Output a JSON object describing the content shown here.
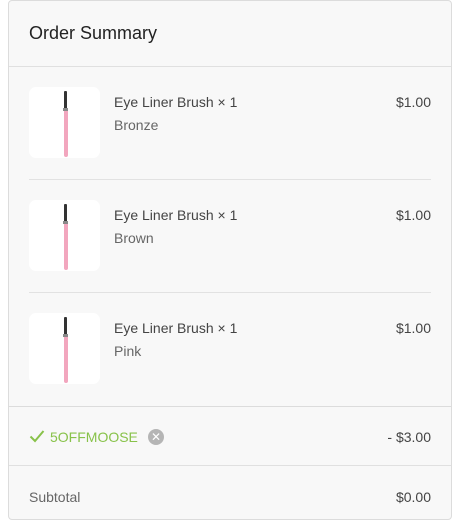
{
  "summary": {
    "title": "Order Summary",
    "items": [
      {
        "name": "Eye Liner Brush",
        "qty": "× 1",
        "variant": "Bronze",
        "price": "$1.00",
        "thumbnail_icon": "eyeliner-brush-icon"
      },
      {
        "name": "Eye Liner Brush",
        "qty": "× 1",
        "variant": "Brown",
        "price": "$1.00",
        "thumbnail_icon": "eyeliner-brush-icon"
      },
      {
        "name": "Eye Liner Brush",
        "qty": "× 1",
        "variant": "Pink",
        "price": "$1.00",
        "thumbnail_icon": "eyeliner-brush-icon"
      }
    ],
    "discount": {
      "code": "5OFFMOOSE",
      "amount": "- $3.00",
      "applied_icon": "check-icon",
      "remove_icon": "close-circle-icon",
      "remove_glyph": "✕",
      "code_color": "#88c24a"
    },
    "subtotal": {
      "label": "Subtotal",
      "value": "$0.00"
    }
  }
}
